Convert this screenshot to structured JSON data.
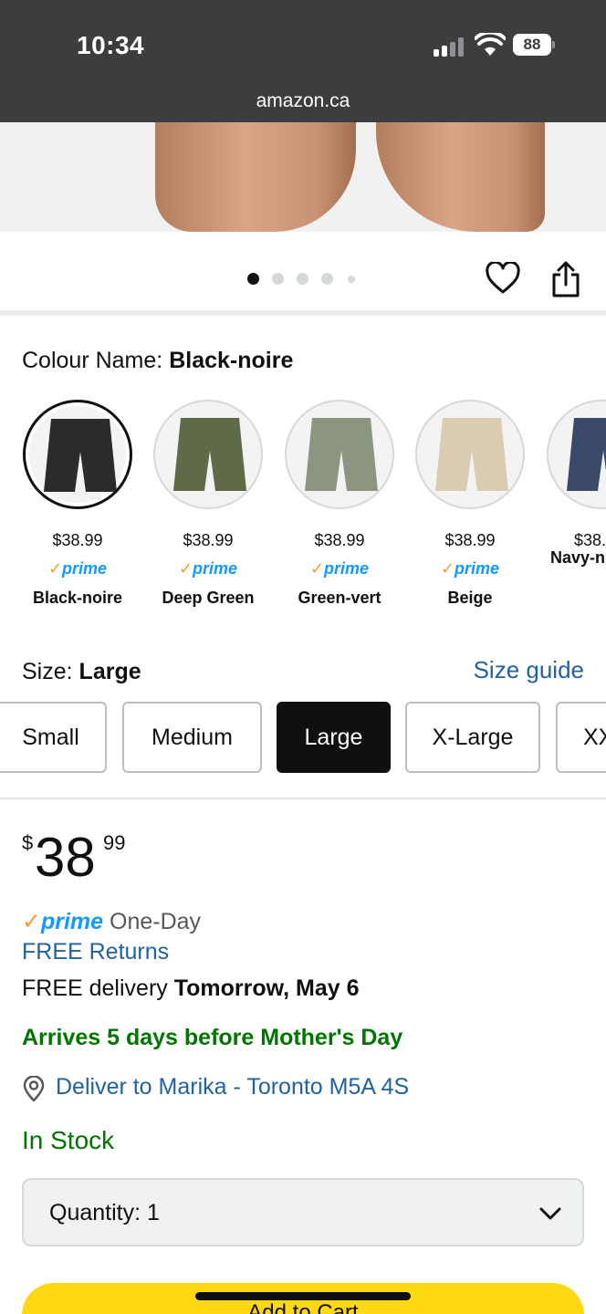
{
  "status_bar": {
    "time": "10:34",
    "battery": "88",
    "url": "amazon.ca"
  },
  "gallery": {
    "dot_count": 5,
    "active_dot": 0
  },
  "colour": {
    "label": "Colour Name:",
    "selected": "Black-noire",
    "options": [
      {
        "price": "$38.99",
        "prime": "prime",
        "name": "Black-noire",
        "color": "#2b2b2b"
      },
      {
        "price": "$38.99",
        "prime": "prime",
        "name": "Deep Green",
        "color": "#5f6b48"
      },
      {
        "price": "$38.99",
        "prime": "prime",
        "name": "Green-vert",
        "color": "#8c9580"
      },
      {
        "price": "$38.99",
        "prime": "prime",
        "name": "Beige",
        "color": "#d9ccb0"
      },
      {
        "price": "$38.",
        "prime": "",
        "name": "Navy-n",
        "color": "#3b4a6b"
      }
    ]
  },
  "size": {
    "label": "Size:",
    "selected": "Large",
    "guide": "Size guide",
    "options": [
      "Small",
      "Medium",
      "Large",
      "X-Large",
      "XX"
    ]
  },
  "price": {
    "symbol": "$",
    "whole": "38",
    "fraction": "99"
  },
  "delivery": {
    "prime_check": "✓",
    "prime_word": "prime",
    "prime_suffix": "One-Day",
    "returns": "FREE Returns",
    "free_delivery": "FREE delivery",
    "delivery_date": "Tomorrow, May 6",
    "arrives": "Arrives 5 days before Mother's Day",
    "deliver_to": "Deliver to Marika - Toronto M5A 4S",
    "stock": "In Stock"
  },
  "quantity": {
    "label": "Quantity:",
    "value": "1"
  },
  "cart": {
    "label": "Add to Cart"
  },
  "colors": {
    "link": "#2162a1",
    "green": "#007600",
    "prime_blue": "#1399ff",
    "cart_yellow": "#ffd814"
  }
}
